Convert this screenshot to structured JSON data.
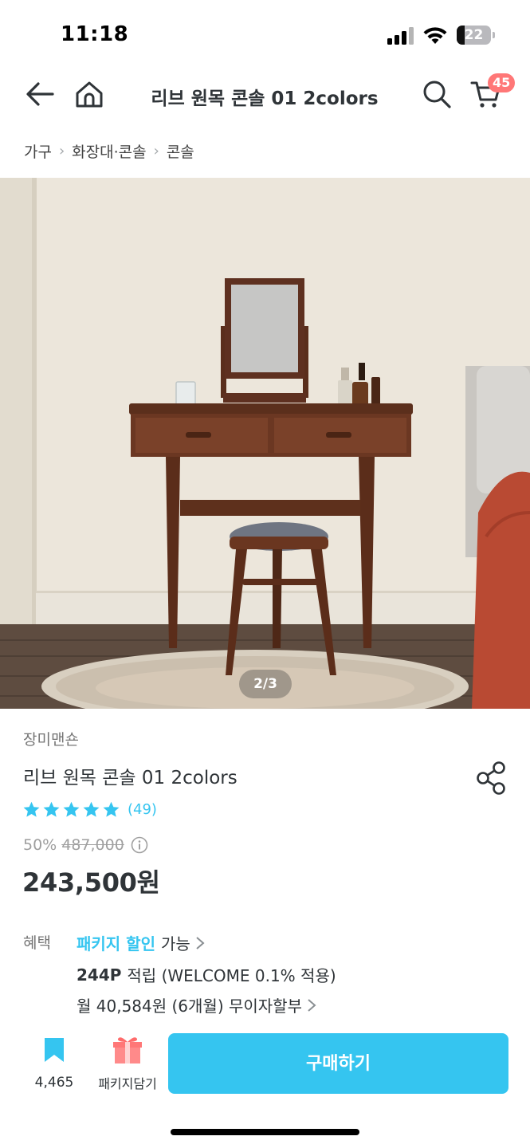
{
  "status_bar": {
    "time": "11:18",
    "battery": "22",
    "icons": [
      "signal-icon",
      "wifi-icon",
      "battery-icon"
    ]
  },
  "header": {
    "title": "리브 원목 콘솔 01 2colors",
    "cart_count": "45",
    "icons": [
      "back-arrow-icon",
      "home-icon",
      "search-icon",
      "cart-icon"
    ]
  },
  "breadcrumb": {
    "items": [
      "가구",
      "화장대·콘솔",
      "콘솔"
    ],
    "separator_icon": "chevron-right-icon"
  },
  "gallery": {
    "indicator": "2/3"
  },
  "product": {
    "brand": "장미맨숀",
    "name": "리브 원목 콘솔 01 2colors",
    "rating_stars": 5,
    "review_count": "(49)",
    "discount_rate": "50%",
    "original_price": "487,000",
    "sale_price": "243,500원"
  },
  "benefits": {
    "label": "혜택",
    "package_highlight": "패키지 할인",
    "package_suffix": "가능",
    "points": "244P",
    "points_text": "적립 (WELCOME 0.1% 적용)",
    "installment": "월 40,584원 (6개월) 무이자할부"
  },
  "bottom_bar": {
    "bookmark_count": "4,465",
    "package_label": "패키지담기",
    "buy_label": "구매하기"
  },
  "colors": {
    "accent": "#35c5f0",
    "badge": "#ff7777",
    "text": "#2f3438",
    "muted": "#757575"
  }
}
